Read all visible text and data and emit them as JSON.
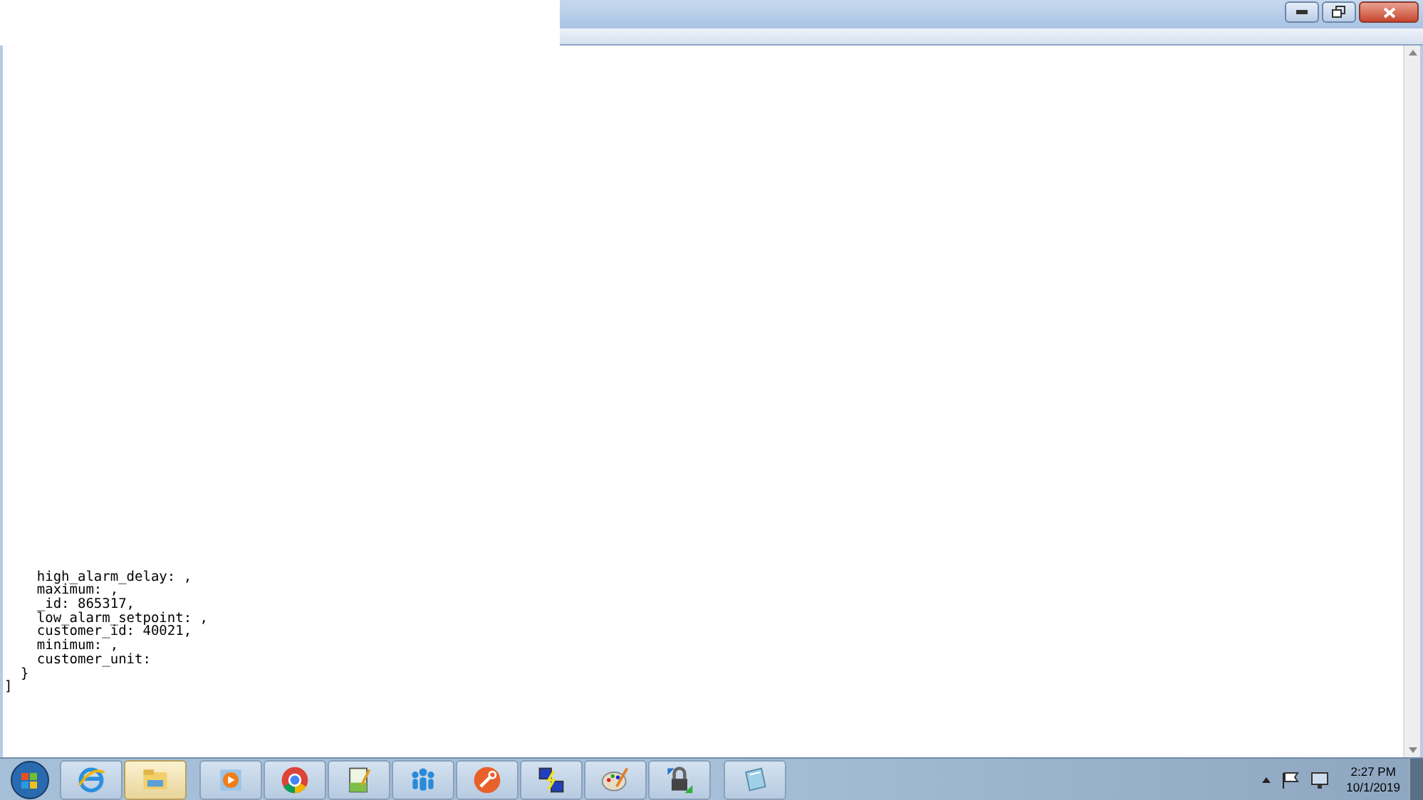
{
  "document": {
    "lines": [
      "    high_alarm_delay: ,",
      "    maximum: ,",
      "    _id: 865317,",
      "    low_alarm_setpoint: ,",
      "    customer_id: 40021,",
      "    minimum: ,",
      "    customer_unit:",
      "  }",
      "]"
    ]
  },
  "taskbar": {
    "apps": [
      {
        "selected": false
      },
      {
        "selected": true
      },
      {
        "selected": false
      },
      {
        "selected": false
      },
      {
        "selected": false
      },
      {
        "selected": false
      },
      {
        "selected": false
      },
      {
        "selected": false
      },
      {
        "selected": false
      },
      {
        "selected": false
      },
      {
        "selected": false
      }
    ],
    "clock": {
      "time": "2:27 PM",
      "date": "10/1/2019"
    }
  }
}
